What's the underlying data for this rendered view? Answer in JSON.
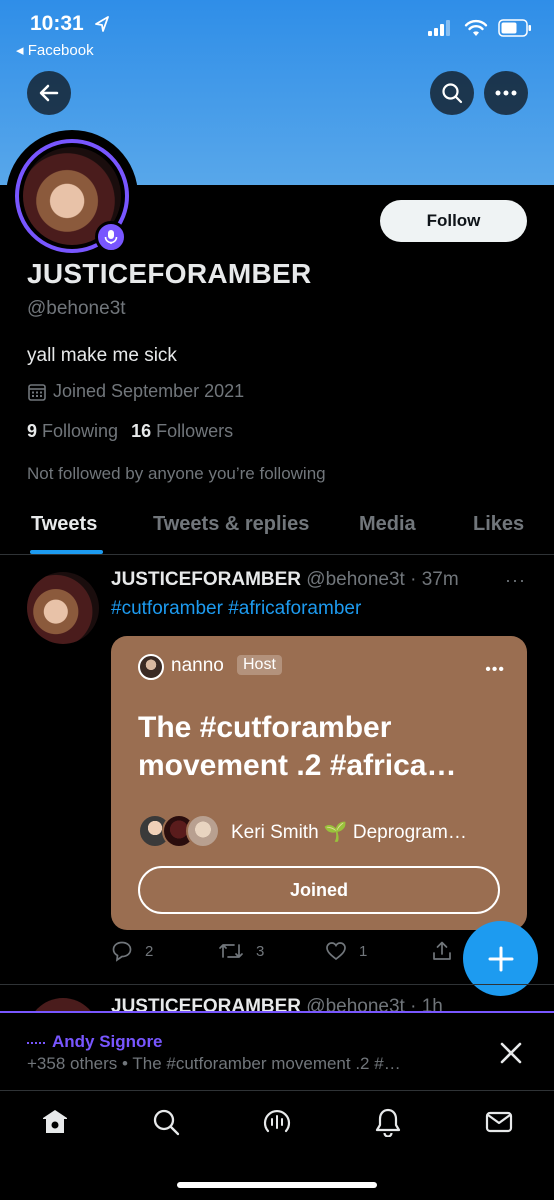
{
  "status_bar": {
    "time": "10:31",
    "back_app": "◂ Facebook"
  },
  "profile": {
    "display_name": "JUSTICEFORAMBER",
    "handle": "@behone3t",
    "bio": "yall make me sick",
    "joined": "Joined September 2021",
    "following_count": "9",
    "following_label": "Following",
    "followers_count": "16",
    "followers_label": "Followers",
    "not_followed": "Not followed by anyone you’re following",
    "follow_label": "Follow"
  },
  "tabs": [
    {
      "label": "Tweets",
      "active": true
    },
    {
      "label": "Tweets & replies",
      "active": false
    },
    {
      "label": "Media",
      "active": false
    },
    {
      "label": "Likes",
      "active": false
    }
  ],
  "tweet": {
    "author": "JUSTICEFORAMBER",
    "meta": " @behone3t · 37m",
    "tags": "#cutforamber #africaforamber",
    "space": {
      "host_name": "nanno",
      "host_badge": "Host",
      "title": "The #cutforamber movement .2 #africa…",
      "speakers_text": "Keri Smith 🌱 Deprogram…",
      "joined_label": "Joined"
    },
    "replies": "2",
    "retweets": "3",
    "likes": "1"
  },
  "next_tweet": {
    "author": "JUSTICEFORAMBER",
    "meta": " @behone3t · 1h"
  },
  "space_dock": {
    "title": "Andy Signore",
    "subtitle": "+358 others • The #cutforamber movement .2 #…"
  },
  "colors": {
    "accent": "#1d9bf0",
    "spaces_purple": "#7856ff",
    "space_card": "#9a6e51",
    "banner": "#3b95e8"
  }
}
